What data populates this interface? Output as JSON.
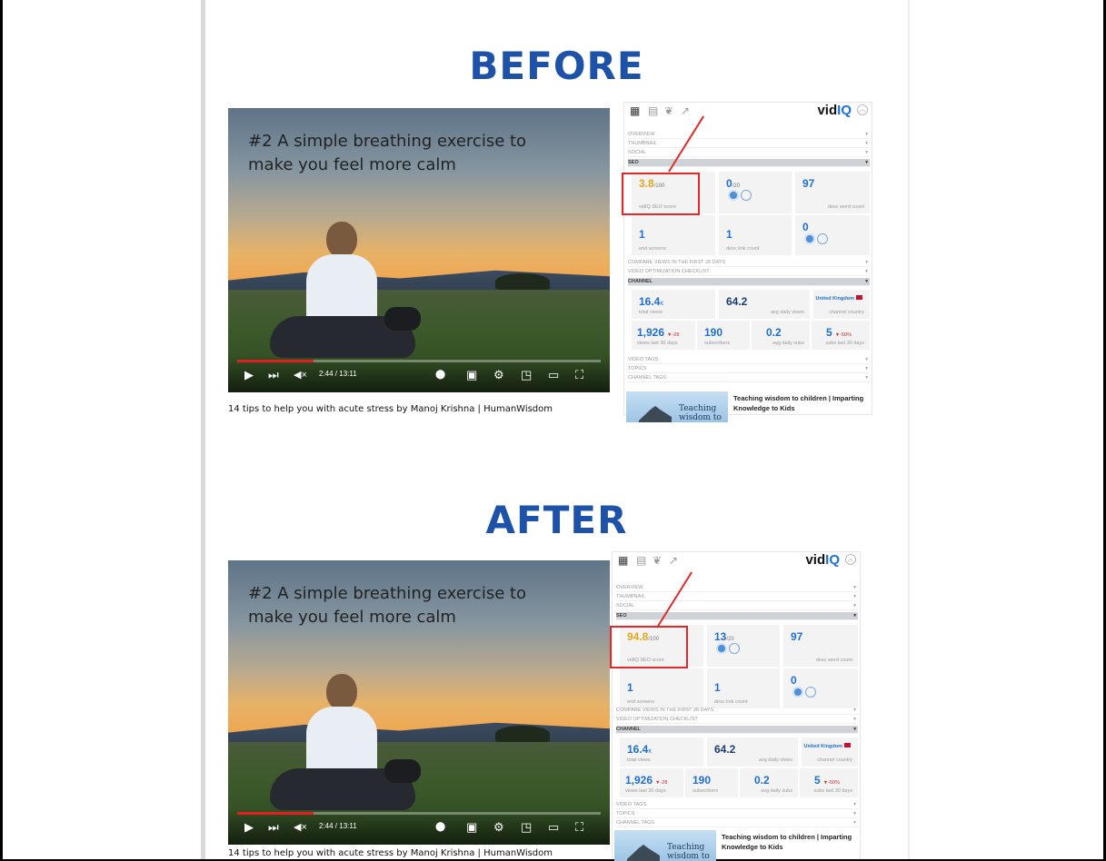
{
  "before": {
    "heading": "BEFORE",
    "video": {
      "title": "#2 A simple breathing exercise to make you feel more calm",
      "time": "2:44 / 13:11",
      "progress": 0.21
    },
    "caption": "14 tips to help you with acute stress by Manoj Krishna | HumanWisdom",
    "panel": {
      "brand_a": "vid",
      "brand_b": "IQ",
      "menu": [
        "OVERVIEW",
        "THUMBNAIL",
        "SOCIAL"
      ],
      "seo_label": "SEO",
      "seo_score": "3.8",
      "seo_score_max": "/100",
      "seo_score_label": "vidIQ SEO score",
      "tags_score": "0",
      "tags_score_max": "/20",
      "desc_word_count": "97",
      "desc_word_count_label": "desc word count",
      "end_screens": "1",
      "end_screens_label": "end screens",
      "desc_link_count": "1",
      "desc_link_count_label": "desc link count",
      "cards_value": "0",
      "menu2": [
        "COMPARE VIEWS IN THE FIRST 28 DAYS",
        "VIDEO OPTIMIZATION CHECKLIST"
      ],
      "channel_label": "CHANNEL",
      "total_views": "16.4",
      "total_views_unit": "K",
      "total_views_label": "total views",
      "avg_daily_views": "64.2",
      "avg_daily_views_label": "avg daily views",
      "channel_country": "United Kingdom",
      "channel_country_label": "channel country",
      "views_30": "1,926",
      "views_30_delta": "▼-28",
      "views_30_label": "views last 30 days",
      "subscribers": "190",
      "subscribers_label": "subscribers",
      "avg_daily_subs": "0.2",
      "avg_daily_subs_label": "avg daily subs",
      "subs_30": "5",
      "subs_30_delta": "▼-50%",
      "subs_30_label": "subs last 30 days",
      "menu3": [
        "VIDEO TAGS",
        "TOPICS",
        "CHANNEL TAGS"
      ],
      "related_thumb": "Teaching wisdom to",
      "related_title": "Teaching wisdom to children | Imparting Knowledge to Kids"
    }
  },
  "after": {
    "heading": "AFTER",
    "video": {
      "title": "#2 A simple breathing exercise to make you feel more calm",
      "time": "2:44 / 13:11",
      "progress": 0.21
    },
    "caption": "14 tips to help you with acute stress by Manoj Krishna | HumanWisdom",
    "panel": {
      "brand_a": "vid",
      "brand_b": "IQ",
      "menu": [
        "OVERVIEW",
        "THUMBNAIL",
        "SOCIAL"
      ],
      "seo_label": "SEO",
      "seo_score": "94.8",
      "seo_score_max": "/100",
      "seo_score_label": "vidIQ SEO score",
      "tags_score": "13",
      "tags_score_max": "/20",
      "desc_word_count": "97",
      "desc_word_count_label": "desc word count",
      "end_screens": "1",
      "end_screens_label": "end screens",
      "desc_link_count": "1",
      "desc_link_count_label": "desc link count",
      "cards_value": "0",
      "menu2": [
        "COMPARE VIEWS IN THE FIRST 28 DAYS",
        "VIDEO OPTIMIZATION CHECKLIST"
      ],
      "channel_label": "CHANNEL",
      "total_views": "16.4",
      "total_views_unit": "K",
      "total_views_label": "total views",
      "avg_daily_views": "64.2",
      "avg_daily_views_label": "avg daily views",
      "channel_country": "United Kingdom",
      "channel_country_label": "channel country",
      "views_30": "1,926",
      "views_30_delta": "▼-28",
      "views_30_label": "views last 30 days",
      "subscribers": "190",
      "subscribers_label": "subscribers",
      "avg_daily_subs": "0.2",
      "avg_daily_subs_label": "avg daily subs",
      "subs_30": "5",
      "subs_30_delta": "▼-50%",
      "subs_30_label": "subs last 30 days",
      "menu3": [
        "VIDEO TAGS",
        "TOPICS",
        "CHANNEL TAGS"
      ],
      "related_thumb": "Teaching wisdom to",
      "related_title": "Teaching wisdom to children | Imparting Knowledge to Kids"
    }
  },
  "icons": {
    "play": "▶",
    "next": "⏭",
    "volume_muted": "🔇",
    "settings": "⚙",
    "grid": "▦"
  },
  "colors": {
    "heading": "#1d52a8",
    "highlight": "#e02a2a",
    "score": "#e5a81b",
    "metric": "#1e6fd0"
  }
}
